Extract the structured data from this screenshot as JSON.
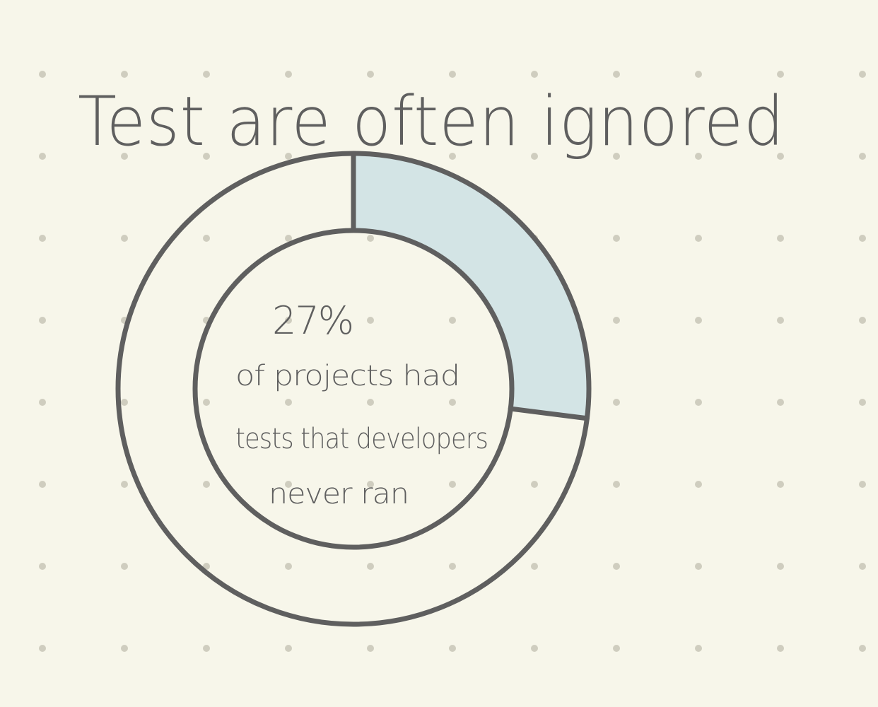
{
  "chart_data": {
    "type": "pie",
    "title": "Test are often ignored",
    "slices": [
      {
        "name": "",
        "value": 27
      },
      {
        "name": "",
        "value": 73
      }
    ],
    "center_value": "27%",
    "center_text": [
      "of projects had",
      "tests that developers",
      "never ran"
    ]
  },
  "colors": {
    "background": "#f7f6ea",
    "ink": "#5f5f5f",
    "highlight": "#d3e4e5",
    "grid_dot": "#cfcdbf"
  }
}
